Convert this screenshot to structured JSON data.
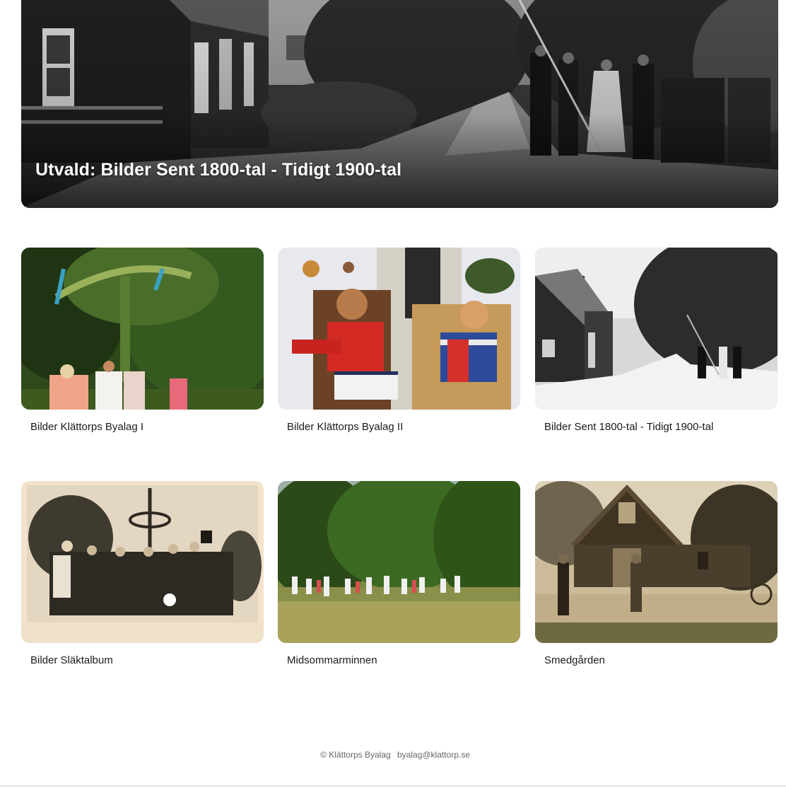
{
  "featured": {
    "title": "Utvald: Bilder Sent 1800-tal - Tidigt 1900-tal"
  },
  "albums": [
    {
      "title": "Bilder Klättorps Byalag I"
    },
    {
      "title": "Bilder Klättorps Byalag II"
    },
    {
      "title": "Bilder Sent 1800-tal - Tidigt 1900-tal"
    },
    {
      "title": "Bilder Släktalbum"
    },
    {
      "title": "Midsommarminnen"
    },
    {
      "title": "Smedgården"
    }
  ],
  "footer": {
    "copyright": "© Klättorps Byalag",
    "email": "byalag@klattorp.se"
  }
}
